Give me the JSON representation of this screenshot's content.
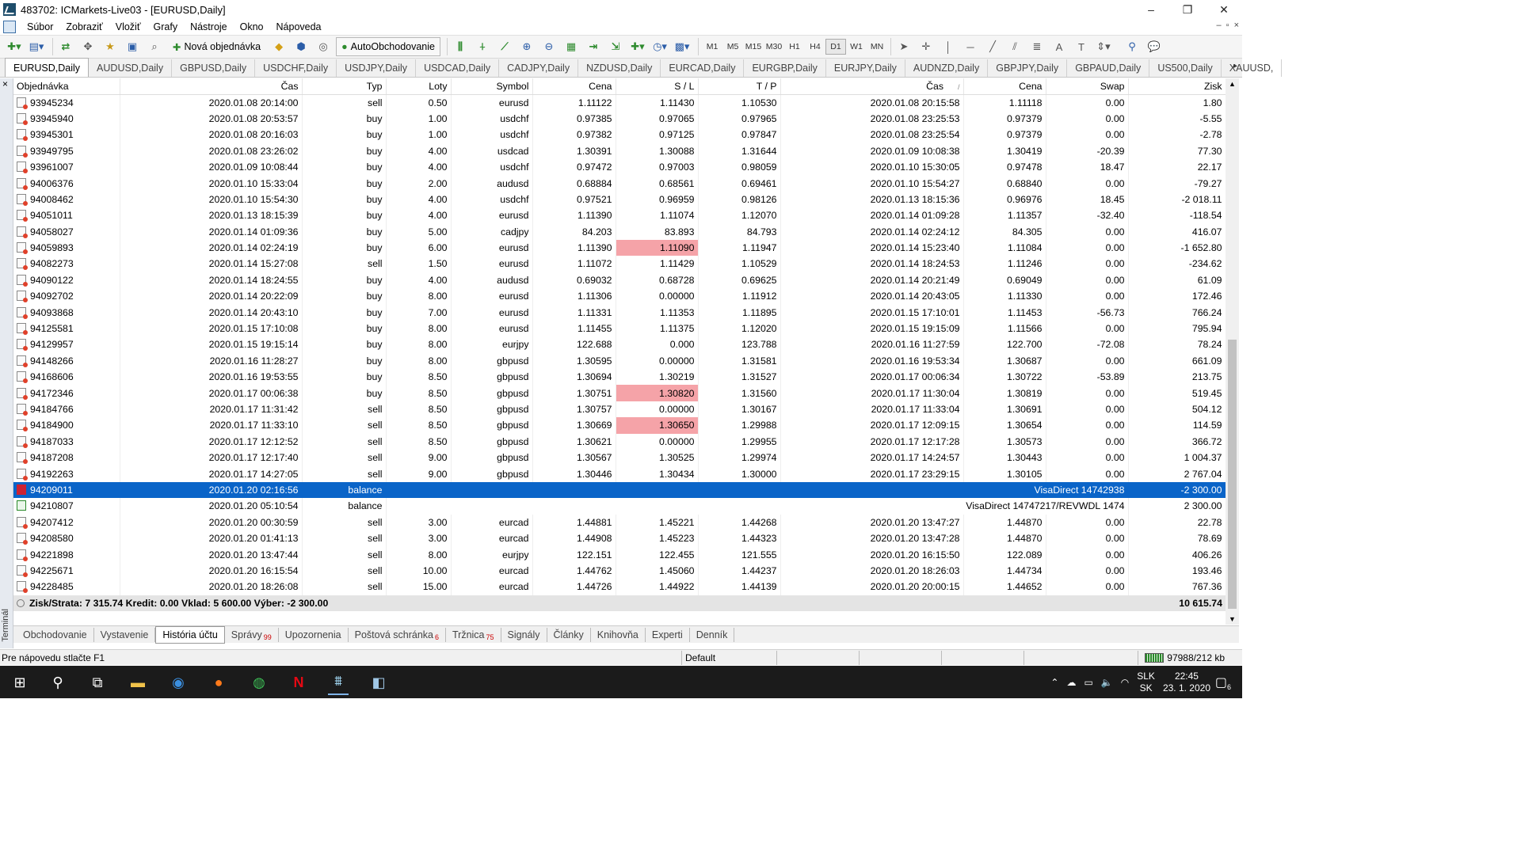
{
  "window": {
    "title": "483702: ICMarkets-Live03 - [EURUSD,Daily]",
    "controls": {
      "minimize": "–",
      "maximize": "❐",
      "close": "✕"
    }
  },
  "menu": {
    "items": [
      "Súbor",
      "Zobraziť",
      "Vložiť",
      "Grafy",
      "Nástroje",
      "Okno",
      "Nápoveda"
    ],
    "mdi": {
      "minimize": "–",
      "restore": "▫",
      "close": "×"
    }
  },
  "toolbar": {
    "new_order": "Nová objednávka",
    "autotrading": "AutoObchodovanie",
    "timeframes": [
      "M1",
      "M5",
      "M15",
      "M30",
      "H1",
      "H4",
      "D1",
      "W1",
      "MN"
    ],
    "active_timeframe": "D1"
  },
  "chart_tabs": {
    "items": [
      "EURUSD,Daily",
      "AUDUSD,Daily",
      "GBPUSD,Daily",
      "USDCHF,Daily",
      "USDJPY,Daily",
      "USDCAD,Daily",
      "CADJPY,Daily",
      "NZDUSD,Daily",
      "EURCAD,Daily",
      "EURGBP,Daily",
      "EURJPY,Daily",
      "AUDNZD,Daily",
      "GBPJPY,Daily",
      "GBPAUD,Daily",
      "US500,Daily",
      "XAUUSD,"
    ],
    "active": "EURUSD,Daily",
    "scroll_icon": "▸"
  },
  "terminal": {
    "side_label": "Terminál",
    "close": "×",
    "columns": [
      "Objednávka",
      "Čas",
      "Typ",
      "Loty",
      "Symbol",
      "Cena",
      "S / L",
      "T / P",
      "Čas",
      "Cena",
      "Swap",
      "Zisk"
    ],
    "sort_indicator": "/",
    "rows": [
      {
        "order": "93945234",
        "open_time": "2020.01.08 20:14:00",
        "type": "sell",
        "lots": "0.50",
        "symbol": "eurusd",
        "price": "1.11122",
        "sl": "1.11430",
        "tp": "1.10530",
        "close_time": "2020.01.08 20:15:58",
        "close_price": "1.11118",
        "swap": "0.00",
        "profit": "1.80"
      },
      {
        "order": "93945940",
        "open_time": "2020.01.08 20:53:57",
        "type": "buy",
        "lots": "1.00",
        "symbol": "usdchf",
        "price": "0.97385",
        "sl": "0.97065",
        "tp": "0.97965",
        "close_time": "2020.01.08 23:25:53",
        "close_price": "0.97379",
        "swap": "0.00",
        "profit": "-5.55"
      },
      {
        "order": "93945301",
        "open_time": "2020.01.08 20:16:03",
        "type": "buy",
        "lots": "1.00",
        "symbol": "usdchf",
        "price": "0.97382",
        "sl": "0.97125",
        "tp": "0.97847",
        "close_time": "2020.01.08 23:25:54",
        "close_price": "0.97379",
        "swap": "0.00",
        "profit": "-2.78"
      },
      {
        "order": "93949795",
        "open_time": "2020.01.08 23:26:02",
        "type": "buy",
        "lots": "4.00",
        "symbol": "usdcad",
        "price": "1.30391",
        "sl": "1.30088",
        "tp": "1.31644",
        "close_time": "2020.01.09 10:08:38",
        "close_price": "1.30419",
        "swap": "-20.39",
        "profit": "77.30"
      },
      {
        "order": "93961007",
        "open_time": "2020.01.09 10:08:44",
        "type": "buy",
        "lots": "4.00",
        "symbol": "usdchf",
        "price": "0.97472",
        "sl": "0.97003",
        "tp": "0.98059",
        "close_time": "2020.01.10 15:30:05",
        "close_price": "0.97478",
        "swap": "18.47",
        "profit": "22.17"
      },
      {
        "order": "94006376",
        "open_time": "2020.01.10 15:33:04",
        "type": "buy",
        "lots": "2.00",
        "symbol": "audusd",
        "price": "0.68884",
        "sl": "0.68561",
        "tp": "0.69461",
        "close_time": "2020.01.10 15:54:27",
        "close_price": "0.68840",
        "swap": "0.00",
        "profit": "-79.27"
      },
      {
        "order": "94008462",
        "open_time": "2020.01.10 15:54:30",
        "type": "buy",
        "lots": "4.00",
        "symbol": "usdchf",
        "price": "0.97521",
        "sl": "0.96959",
        "tp": "0.98126",
        "close_time": "2020.01.13 18:15:36",
        "close_price": "0.96976",
        "swap": "18.45",
        "profit": "-2 018.11"
      },
      {
        "order": "94051011",
        "open_time": "2020.01.13 18:15:39",
        "type": "buy",
        "lots": "4.00",
        "symbol": "eurusd",
        "price": "1.11390",
        "sl": "1.11074",
        "tp": "1.12070",
        "close_time": "2020.01.14 01:09:28",
        "close_price": "1.11357",
        "swap": "-32.40",
        "profit": "-118.54"
      },
      {
        "order": "94058027",
        "open_time": "2020.01.14 01:09:36",
        "type": "buy",
        "lots": "5.00",
        "symbol": "cadjpy",
        "price": "84.203",
        "sl": "83.893",
        "tp": "84.793",
        "close_time": "2020.01.14 02:24:12",
        "close_price": "84.305",
        "swap": "0.00",
        "profit": "416.07"
      },
      {
        "order": "94059893",
        "open_time": "2020.01.14 02:24:19",
        "type": "buy",
        "lots": "6.00",
        "symbol": "eurusd",
        "price": "1.11390",
        "sl": "1.11090",
        "tp": "1.11947",
        "close_time": "2020.01.14 15:23:40",
        "close_price": "1.11084",
        "swap": "0.00",
        "profit": "-1 652.80",
        "sl_hit": true
      },
      {
        "order": "94082273",
        "open_time": "2020.01.14 15:27:08",
        "type": "sell",
        "lots": "1.50",
        "symbol": "eurusd",
        "price": "1.11072",
        "sl": "1.11429",
        "tp": "1.10529",
        "close_time": "2020.01.14 18:24:53",
        "close_price": "1.11246",
        "swap": "0.00",
        "profit": "-234.62"
      },
      {
        "order": "94090122",
        "open_time": "2020.01.14 18:24:55",
        "type": "buy",
        "lots": "4.00",
        "symbol": "audusd",
        "price": "0.69032",
        "sl": "0.68728",
        "tp": "0.69625",
        "close_time": "2020.01.14 20:21:49",
        "close_price": "0.69049",
        "swap": "0.00",
        "profit": "61.09"
      },
      {
        "order": "94092702",
        "open_time": "2020.01.14 20:22:09",
        "type": "buy",
        "lots": "8.00",
        "symbol": "eurusd",
        "price": "1.11306",
        "sl": "0.00000",
        "tp": "1.11912",
        "close_time": "2020.01.14 20:43:05",
        "close_price": "1.11330",
        "swap": "0.00",
        "profit": "172.46"
      },
      {
        "order": "94093868",
        "open_time": "2020.01.14 20:43:10",
        "type": "buy",
        "lots": "7.00",
        "symbol": "eurusd",
        "price": "1.11331",
        "sl": "1.11353",
        "tp": "1.11895",
        "close_time": "2020.01.15 17:10:01",
        "close_price": "1.11453",
        "swap": "-56.73",
        "profit": "766.24"
      },
      {
        "order": "94125581",
        "open_time": "2020.01.15 17:10:08",
        "type": "buy",
        "lots": "8.00",
        "symbol": "eurusd",
        "price": "1.11455",
        "sl": "1.11375",
        "tp": "1.12020",
        "close_time": "2020.01.15 19:15:09",
        "close_price": "1.11566",
        "swap": "0.00",
        "profit": "795.94"
      },
      {
        "order": "94129957",
        "open_time": "2020.01.15 19:15:14",
        "type": "buy",
        "lots": "8.00",
        "symbol": "eurjpy",
        "price": "122.688",
        "sl": "0.000",
        "tp": "123.788",
        "close_time": "2020.01.16 11:27:59",
        "close_price": "122.700",
        "swap": "-72.08",
        "profit": "78.24"
      },
      {
        "order": "94148266",
        "open_time": "2020.01.16 11:28:27",
        "type": "buy",
        "lots": "8.00",
        "symbol": "gbpusd",
        "price": "1.30595",
        "sl": "0.00000",
        "tp": "1.31581",
        "close_time": "2020.01.16 19:53:34",
        "close_price": "1.30687",
        "swap": "0.00",
        "profit": "661.09"
      },
      {
        "order": "94168606",
        "open_time": "2020.01.16 19:53:55",
        "type": "buy",
        "lots": "8.50",
        "symbol": "gbpusd",
        "price": "1.30694",
        "sl": "1.30219",
        "tp": "1.31527",
        "close_time": "2020.01.17 00:06:34",
        "close_price": "1.30722",
        "swap": "-53.89",
        "profit": "213.75"
      },
      {
        "order": "94172346",
        "open_time": "2020.01.17 00:06:38",
        "type": "buy",
        "lots": "8.50",
        "symbol": "gbpusd",
        "price": "1.30751",
        "sl": "1.30820",
        "tp": "1.31560",
        "close_time": "2020.01.17 11:30:04",
        "close_price": "1.30819",
        "swap": "0.00",
        "profit": "519.45",
        "sl_hit": true
      },
      {
        "order": "94184766",
        "open_time": "2020.01.17 11:31:42",
        "type": "sell",
        "lots": "8.50",
        "symbol": "gbpusd",
        "price": "1.30757",
        "sl": "0.00000",
        "tp": "1.30167",
        "close_time": "2020.01.17 11:33:04",
        "close_price": "1.30691",
        "swap": "0.00",
        "profit": "504.12"
      },
      {
        "order": "94184900",
        "open_time": "2020.01.17 11:33:10",
        "type": "sell",
        "lots": "8.50",
        "symbol": "gbpusd",
        "price": "1.30669",
        "sl": "1.30650",
        "tp": "1.29988",
        "close_time": "2020.01.17 12:09:15",
        "close_price": "1.30654",
        "swap": "0.00",
        "profit": "114.59",
        "sl_hit": true
      },
      {
        "order": "94187033",
        "open_time": "2020.01.17 12:12:52",
        "type": "sell",
        "lots": "8.50",
        "symbol": "gbpusd",
        "price": "1.30621",
        "sl": "0.00000",
        "tp": "1.29955",
        "close_time": "2020.01.17 12:17:28",
        "close_price": "1.30573",
        "swap": "0.00",
        "profit": "366.72"
      },
      {
        "order": "94187208",
        "open_time": "2020.01.17 12:17:40",
        "type": "sell",
        "lots": "9.00",
        "symbol": "gbpusd",
        "price": "1.30567",
        "sl": "1.30525",
        "tp": "1.29974",
        "close_time": "2020.01.17 14:24:57",
        "close_price": "1.30443",
        "swap": "0.00",
        "profit": "1 004.37"
      },
      {
        "order": "94192263",
        "open_time": "2020.01.17 14:27:05",
        "type": "sell",
        "lots": "9.00",
        "symbol": "gbpusd",
        "price": "1.30446",
        "sl": "1.30434",
        "tp": "1.30000",
        "close_time": "2020.01.17 23:29:15",
        "close_price": "1.30105",
        "swap": "0.00",
        "profit": "2 767.04"
      },
      {
        "order": "94209011",
        "open_time": "2020.01.20 02:16:56",
        "type": "balance",
        "comment": "VisaDirect 14742938",
        "profit": "-2 300.00",
        "selected": true,
        "balance_dir": "out"
      },
      {
        "order": "94210807",
        "open_time": "2020.01.20 05:10:54",
        "type": "balance",
        "comment": "VisaDirect 14747217/REVWDL 1474",
        "profit": "2 300.00",
        "balance_dir": "in"
      },
      {
        "order": "94207412",
        "open_time": "2020.01.20 00:30:59",
        "type": "sell",
        "lots": "3.00",
        "symbol": "eurcad",
        "price": "1.44881",
        "sl": "1.45221",
        "tp": "1.44268",
        "close_time": "2020.01.20 13:47:27",
        "close_price": "1.44870",
        "swap": "0.00",
        "profit": "22.78"
      },
      {
        "order": "94208580",
        "open_time": "2020.01.20 01:41:13",
        "type": "sell",
        "lots": "3.00",
        "symbol": "eurcad",
        "price": "1.44908",
        "sl": "1.45223",
        "tp": "1.44323",
        "close_time": "2020.01.20 13:47:28",
        "close_price": "1.44870",
        "swap": "0.00",
        "profit": "78.69"
      },
      {
        "order": "94221898",
        "open_time": "2020.01.20 13:47:44",
        "type": "sell",
        "lots": "8.00",
        "symbol": "eurjpy",
        "price": "122.151",
        "sl": "122.455",
        "tp": "121.555",
        "close_time": "2020.01.20 16:15:50",
        "close_price": "122.089",
        "swap": "0.00",
        "profit": "406.26"
      },
      {
        "order": "94225671",
        "open_time": "2020.01.20 16:15:54",
        "type": "sell",
        "lots": "10.00",
        "symbol": "eurcad",
        "price": "1.44762",
        "sl": "1.45060",
        "tp": "1.44237",
        "close_time": "2020.01.20 18:26:03",
        "close_price": "1.44734",
        "swap": "0.00",
        "profit": "193.46"
      },
      {
        "order": "94228485",
        "open_time": "2020.01.20 18:26:08",
        "type": "sell",
        "lots": "15.00",
        "symbol": "eurcad",
        "price": "1.44726",
        "sl": "1.44922",
        "tp": "1.44139",
        "close_time": "2020.01.20 20:00:15",
        "close_price": "1.44652",
        "swap": "0.00",
        "profit": "767.36"
      }
    ],
    "summary": {
      "text": "Zisk/Strata: 7 315.74  Kredit: 0.00  Vklad: 5 600.00  Výber: -2 300.00",
      "total": "10 615.74"
    },
    "tabs": [
      {
        "label": "Obchodovanie"
      },
      {
        "label": "Vystavenie"
      },
      {
        "label": "História účtu",
        "active": true
      },
      {
        "label": "Správy",
        "badge": "99"
      },
      {
        "label": "Upozornenia"
      },
      {
        "label": "Poštová schránka",
        "badge": "6"
      },
      {
        "label": "Tržnica",
        "badge": "75"
      },
      {
        "label": "Signály"
      },
      {
        "label": "Články"
      },
      {
        "label": "Knihovňa"
      },
      {
        "label": "Experti"
      },
      {
        "label": "Denník"
      }
    ]
  },
  "statusbar": {
    "help": "Pre nápovedu stlačte F1",
    "profile": "Default",
    "traffic": "97988/212 kb"
  },
  "taskbar": {
    "lang_top": "SLK",
    "lang_bottom": "SK",
    "time": "22:45",
    "date": "23. 1. 2020",
    "notifications": "6"
  }
}
